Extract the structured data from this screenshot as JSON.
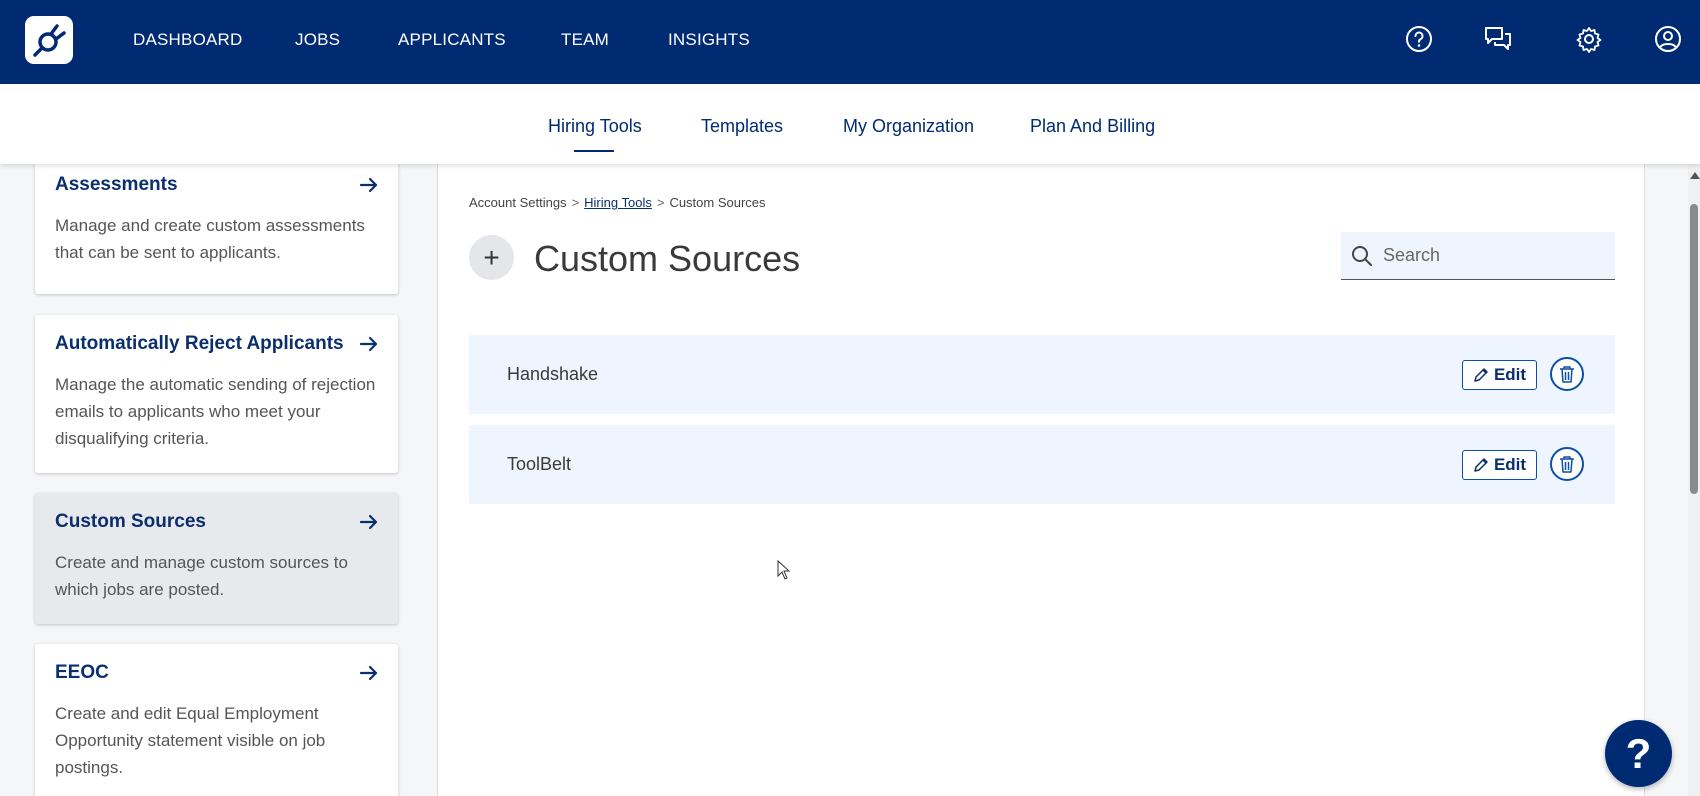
{
  "topnav": {
    "items": [
      "DASHBOARD",
      "JOBS",
      "APPLICANTS",
      "TEAM",
      "INSIGHTS"
    ],
    "icons": [
      "help-icon",
      "chat-icon",
      "gear-icon",
      "user-icon"
    ]
  },
  "subnav": {
    "items": [
      "Hiring Tools",
      "Templates",
      "My Organization",
      "Plan And Billing"
    ],
    "active": "Hiring Tools"
  },
  "sidebar": {
    "cards": [
      {
        "title": "Assessments",
        "desc": "Manage and create custom assessments that can be sent to applicants."
      },
      {
        "title": "Automatically Reject Applicants",
        "desc": "Manage the automatic sending of rejection emails to applicants who meet your disqualifying criteria."
      },
      {
        "title": "Custom Sources",
        "desc": "Create and manage custom sources to which jobs are posted."
      },
      {
        "title": "EEOC",
        "desc": "Create and edit Equal Employment Opportunity statement visible on job postings."
      }
    ]
  },
  "breadcrumb": {
    "root": "Account Settings",
    "parent": "Hiring Tools",
    "current": "Custom Sources"
  },
  "main": {
    "add_symbol": "+",
    "title": "Custom Sources",
    "search_placeholder": "Search",
    "edit_label": "Edit",
    "sources": [
      "Handshake",
      "ToolBelt"
    ]
  },
  "help_fab": "?",
  "colors": {
    "primary": "#002b73",
    "row_bg": "#eef5ff",
    "accent_border": "#0a4fa8"
  }
}
